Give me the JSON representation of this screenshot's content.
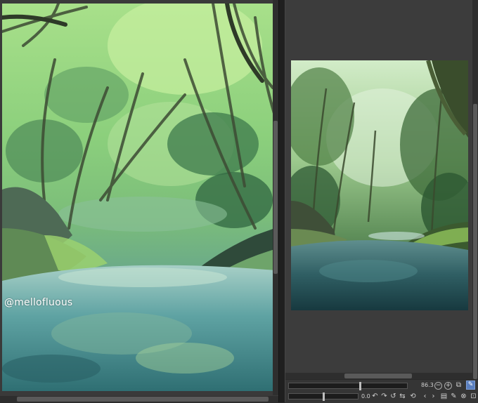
{
  "canvas": {
    "watermark_text": "@mellofluous"
  },
  "navigator": {
    "zoom_value": "86.3",
    "rotation_value": "0.0"
  },
  "colors": {
    "background": "#2b2b2b",
    "pane": "#3a3a3a",
    "accent": "#5a7fbf"
  }
}
